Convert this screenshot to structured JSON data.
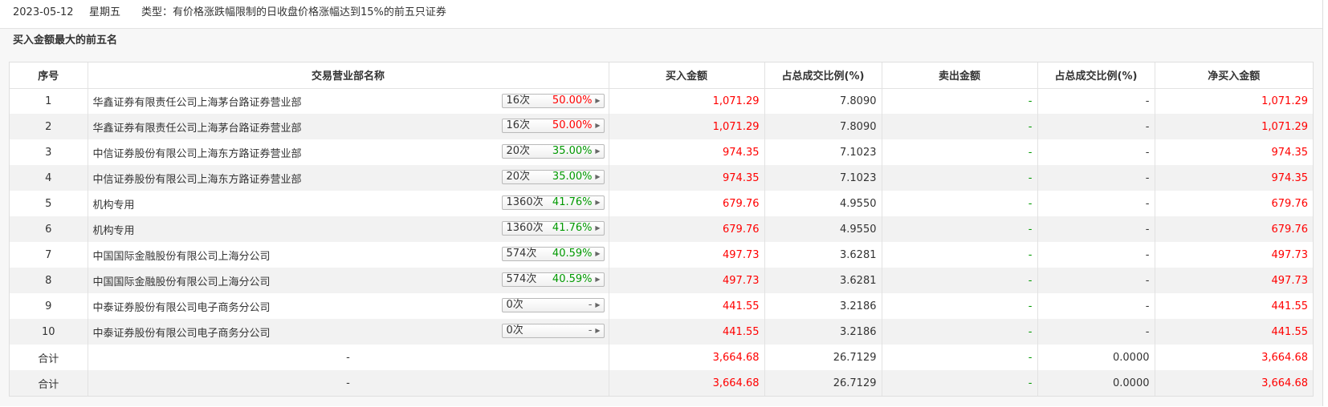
{
  "header": {
    "date": "2023-05-12",
    "weekday": "星期五",
    "type_label": "类型：有价格涨跌幅限制的日收盘价格涨幅达到15%的前五只证券"
  },
  "section": {
    "title": "买入金额最大的前五名"
  },
  "columns": [
    "序号",
    "交易营业部名称",
    "买入金额",
    "占总成交比例(%)",
    "卖出金额",
    "占总成交比例(%)",
    "净买入金额"
  ],
  "colors": {
    "up": "#ff0000",
    "down": "#009900"
  },
  "rows": [
    {
      "no": "1",
      "name": "华鑫证券有限责任公司上海茅台路证券营业部",
      "count": "16次",
      "pct": "50.00%",
      "pct_color": "red",
      "buy": "1,071.29",
      "buy_ratio": "7.8090",
      "sell": "-",
      "sell_ratio": "-",
      "net": "1,071.29"
    },
    {
      "no": "2",
      "name": "华鑫证券有限责任公司上海茅台路证券营业部",
      "count": "16次",
      "pct": "50.00%",
      "pct_color": "red",
      "buy": "1,071.29",
      "buy_ratio": "7.8090",
      "sell": "-",
      "sell_ratio": "-",
      "net": "1,071.29"
    },
    {
      "no": "3",
      "name": "中信证券股份有限公司上海东方路证券营业部",
      "count": "20次",
      "pct": "35.00%",
      "pct_color": "green",
      "buy": "974.35",
      "buy_ratio": "7.1023",
      "sell": "-",
      "sell_ratio": "-",
      "net": "974.35"
    },
    {
      "no": "4",
      "name": "中信证券股份有限公司上海东方路证券营业部",
      "count": "20次",
      "pct": "35.00%",
      "pct_color": "green",
      "buy": "974.35",
      "buy_ratio": "7.1023",
      "sell": "-",
      "sell_ratio": "-",
      "net": "974.35"
    },
    {
      "no": "5",
      "name": "机构专用",
      "count": "1360次",
      "pct": "41.76%",
      "pct_color": "green",
      "buy": "679.76",
      "buy_ratio": "4.9550",
      "sell": "-",
      "sell_ratio": "-",
      "net": "679.76"
    },
    {
      "no": "6",
      "name": "机构专用",
      "count": "1360次",
      "pct": "41.76%",
      "pct_color": "green",
      "buy": "679.76",
      "buy_ratio": "4.9550",
      "sell": "-",
      "sell_ratio": "-",
      "net": "679.76"
    },
    {
      "no": "7",
      "name": "中国国际金融股份有限公司上海分公司",
      "count": "574次",
      "pct": "40.59%",
      "pct_color": "green",
      "buy": "497.73",
      "buy_ratio": "3.6281",
      "sell": "-",
      "sell_ratio": "-",
      "net": "497.73"
    },
    {
      "no": "8",
      "name": "中国国际金融股份有限公司上海分公司",
      "count": "574次",
      "pct": "40.59%",
      "pct_color": "green",
      "buy": "497.73",
      "buy_ratio": "3.6281",
      "sell": "-",
      "sell_ratio": "-",
      "net": "497.73"
    },
    {
      "no": "9",
      "name": "中泰证券股份有限公司电子商务分公司",
      "count": "0次",
      "pct": "-",
      "pct_color": "dash",
      "buy": "441.55",
      "buy_ratio": "3.2186",
      "sell": "-",
      "sell_ratio": "-",
      "net": "441.55"
    },
    {
      "no": "10",
      "name": "中泰证券股份有限公司电子商务分公司",
      "count": "0次",
      "pct": "-",
      "pct_color": "dash",
      "buy": "441.55",
      "buy_ratio": "3.2186",
      "sell": "-",
      "sell_ratio": "-",
      "net": "441.55"
    }
  ],
  "totals": [
    {
      "label": "合计",
      "name": "-",
      "buy": "3,664.68",
      "buy_ratio": "26.7129",
      "sell": "-",
      "sell_ratio": "0.0000",
      "net": "3,664.68"
    },
    {
      "label": "合计",
      "name": "-",
      "buy": "3,664.68",
      "buy_ratio": "26.7129",
      "sell": "-",
      "sell_ratio": "0.0000",
      "net": "3,664.68"
    }
  ],
  "icons": {
    "row_expand": "triangle-right-icon"
  }
}
